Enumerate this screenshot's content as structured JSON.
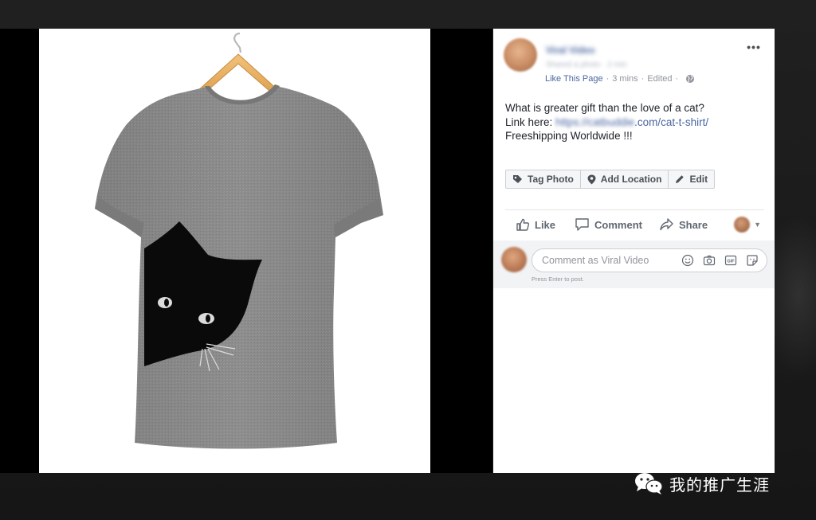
{
  "post": {
    "author_name": "Viral Video",
    "author_subline": "Shared a photo · 2 min",
    "meta": {
      "like_page": "Like This Page",
      "sep1": "·",
      "time": "3 mins",
      "sep2": "·",
      "edited": "Edited",
      "sep3": "·"
    },
    "text": {
      "line1": "What is greater gift than the love of a cat?",
      "line2_prefix": "Link here: ",
      "link_blurred": "https://catbuddie",
      "link_visible": ".com/cat-t-shirt/",
      "line3": "Freeshipping Worldwide !!!"
    },
    "more_label": "•••"
  },
  "photo_actions": {
    "tag_photo": "Tag Photo",
    "add_location": "Add Location",
    "edit": "Edit"
  },
  "reactions": {
    "like": "Like",
    "comment": "Comment",
    "share": "Share",
    "caret": "▼"
  },
  "comment": {
    "placeholder": "Comment as Viral Video",
    "hint": "Press Enter to post."
  },
  "icons": {
    "globe": "globe-icon",
    "tag": "tag-icon",
    "pin": "location-pin-icon",
    "pencil": "pencil-icon",
    "thumbs_up": "thumbs-up-icon",
    "speech": "speech-bubble-icon",
    "share_arrow": "share-arrow-icon",
    "emoji": "smiley-icon",
    "camera": "camera-icon",
    "gif": "gif-icon",
    "sticker": "sticker-icon",
    "wechat": "wechat-icon"
  },
  "colors": {
    "link": "#4b67a1",
    "shirt": "#8e8e8e",
    "cat": "#0a0a0a",
    "panel": "#ffffff",
    "comment_bg": "#f2f3f5"
  },
  "watermark": {
    "text": "我的推广生涯"
  }
}
